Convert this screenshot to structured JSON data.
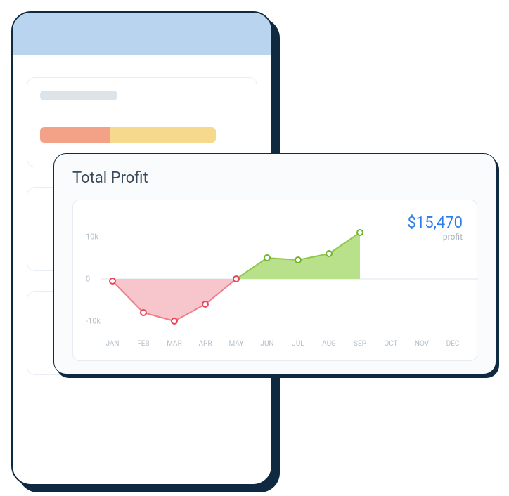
{
  "chart": {
    "title": "Total Profit",
    "metric_value": "$15,470",
    "metric_label": "profit",
    "y_ticks": [
      "10k",
      "0",
      "-10k"
    ],
    "x_ticks": [
      "JAN",
      "FEB",
      "MAR",
      "APR",
      "MAY",
      "JUN",
      "JUL",
      "AUG",
      "SEP",
      "OCT",
      "NOV",
      "DEC"
    ]
  },
  "chart_data": {
    "type": "area",
    "title": "Total Profit",
    "xlabel": "",
    "ylabel": "",
    "ylim": [
      -12,
      12
    ],
    "categories": [
      "JAN",
      "FEB",
      "MAR",
      "APR",
      "MAY",
      "JUN",
      "JUL",
      "AUG",
      "SEP",
      "OCT",
      "NOV",
      "DEC"
    ],
    "series": [
      {
        "name": "profit",
        "values": [
          -0.5,
          -8,
          -10,
          -6,
          0,
          5,
          4.5,
          6,
          11,
          null,
          null,
          null
        ]
      }
    ],
    "metric": {
      "label": "profit",
      "value": 15470,
      "display": "$15,470"
    }
  }
}
